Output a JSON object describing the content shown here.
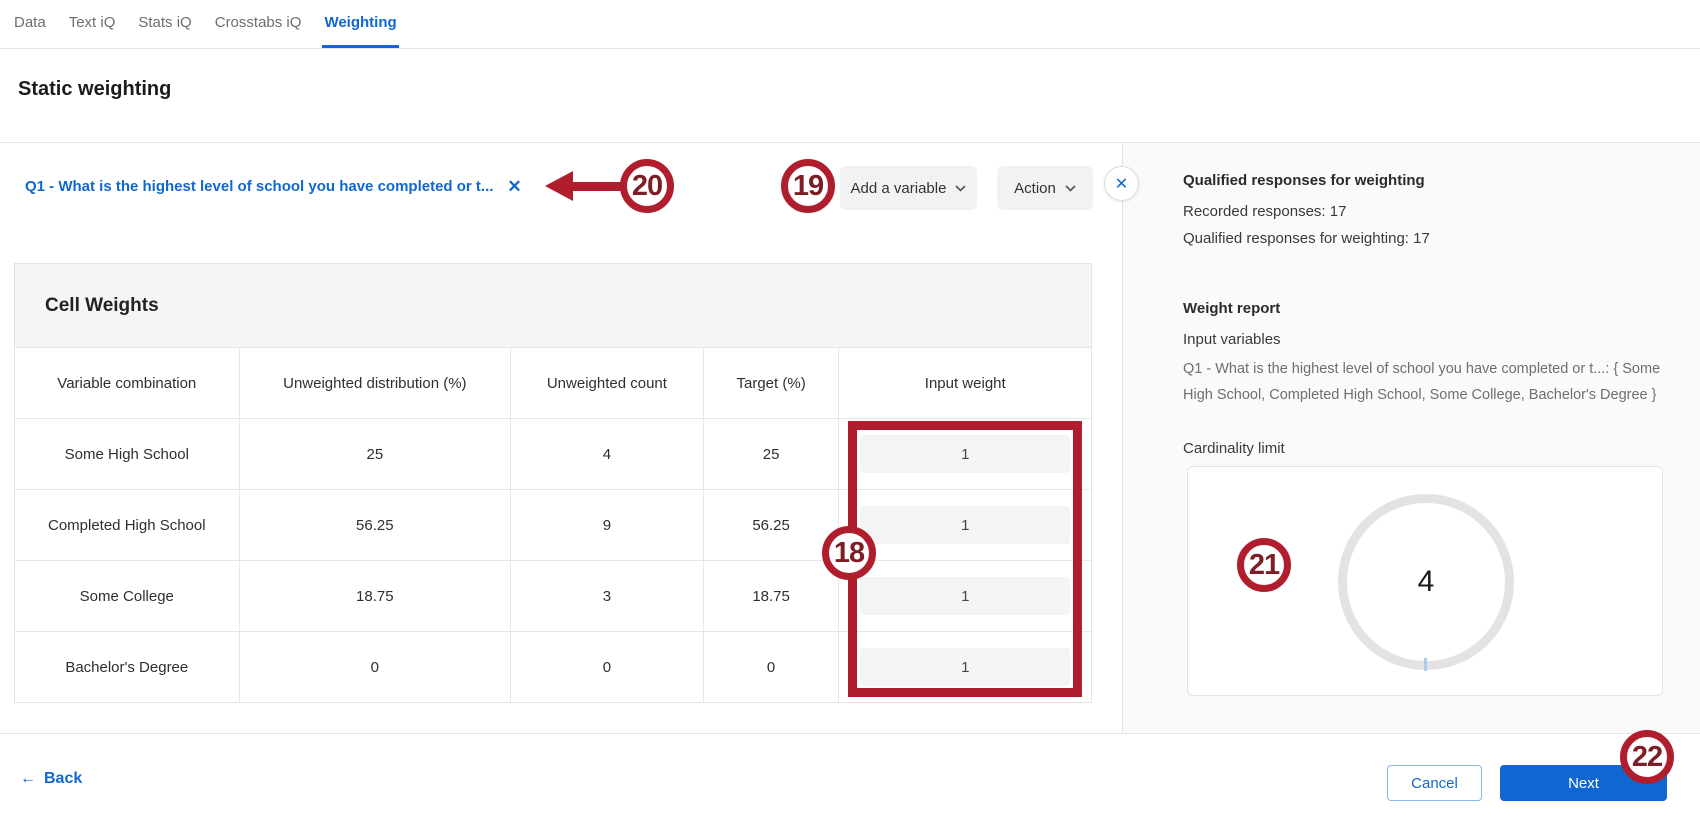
{
  "tabs": [
    {
      "label": "Data",
      "active": false
    },
    {
      "label": "Text iQ",
      "active": false
    },
    {
      "label": "Stats iQ",
      "active": false
    },
    {
      "label": "Crosstabs iQ",
      "active": false
    },
    {
      "label": "Weighting",
      "active": true
    }
  ],
  "page_title": "Static weighting",
  "variable_chip": {
    "label": "Q1 - What is the highest level of school you have completed or t...",
    "remove_icon": "close-x"
  },
  "toolbar": {
    "add_variable_label": "Add a variable",
    "action_label": "Action",
    "panel_close_icon": "close-x"
  },
  "table": {
    "title": "Cell Weights",
    "headers": [
      "Variable combination",
      "Unweighted distribution (%)",
      "Unweighted count",
      "Target (%)",
      "Input weight"
    ],
    "rows": [
      {
        "variable": "Some High School",
        "distribution": "25",
        "count": "4",
        "target": "25",
        "weight": "1"
      },
      {
        "variable": "Completed High School",
        "distribution": "56.25",
        "count": "9",
        "target": "56.25",
        "weight": "1"
      },
      {
        "variable": "Some College",
        "distribution": "18.75",
        "count": "3",
        "target": "18.75",
        "weight": "1"
      },
      {
        "variable": "Bachelor's Degree",
        "distribution": "0",
        "count": "0",
        "target": "0",
        "weight": "1"
      }
    ]
  },
  "panel": {
    "heading": "Qualified responses for weighting",
    "recorded": "Recorded responses: 17",
    "qualified": "Qualified responses for weighting: 17",
    "weight_report_heading": "Weight report",
    "input_variables_label": "Input variables",
    "input_variable_detail": "Q1 - What is the highest level of school you have completed or t...: { Some High School, Completed High School, Some College, Bachelor's Degree }",
    "cardinality_label": "Cardinality limit",
    "cardinality_value": "4"
  },
  "footer": {
    "back_label": "Back",
    "cancel_label": "Cancel",
    "next_label": "Next"
  },
  "annotations": {
    "n18": "18",
    "n19": "19",
    "n20": "20",
    "n21": "21",
    "n22": "22",
    "color": "#b01e2e"
  },
  "colors": {
    "accent_blue": "#1167d2",
    "annotation_red": "#b01e2e"
  }
}
